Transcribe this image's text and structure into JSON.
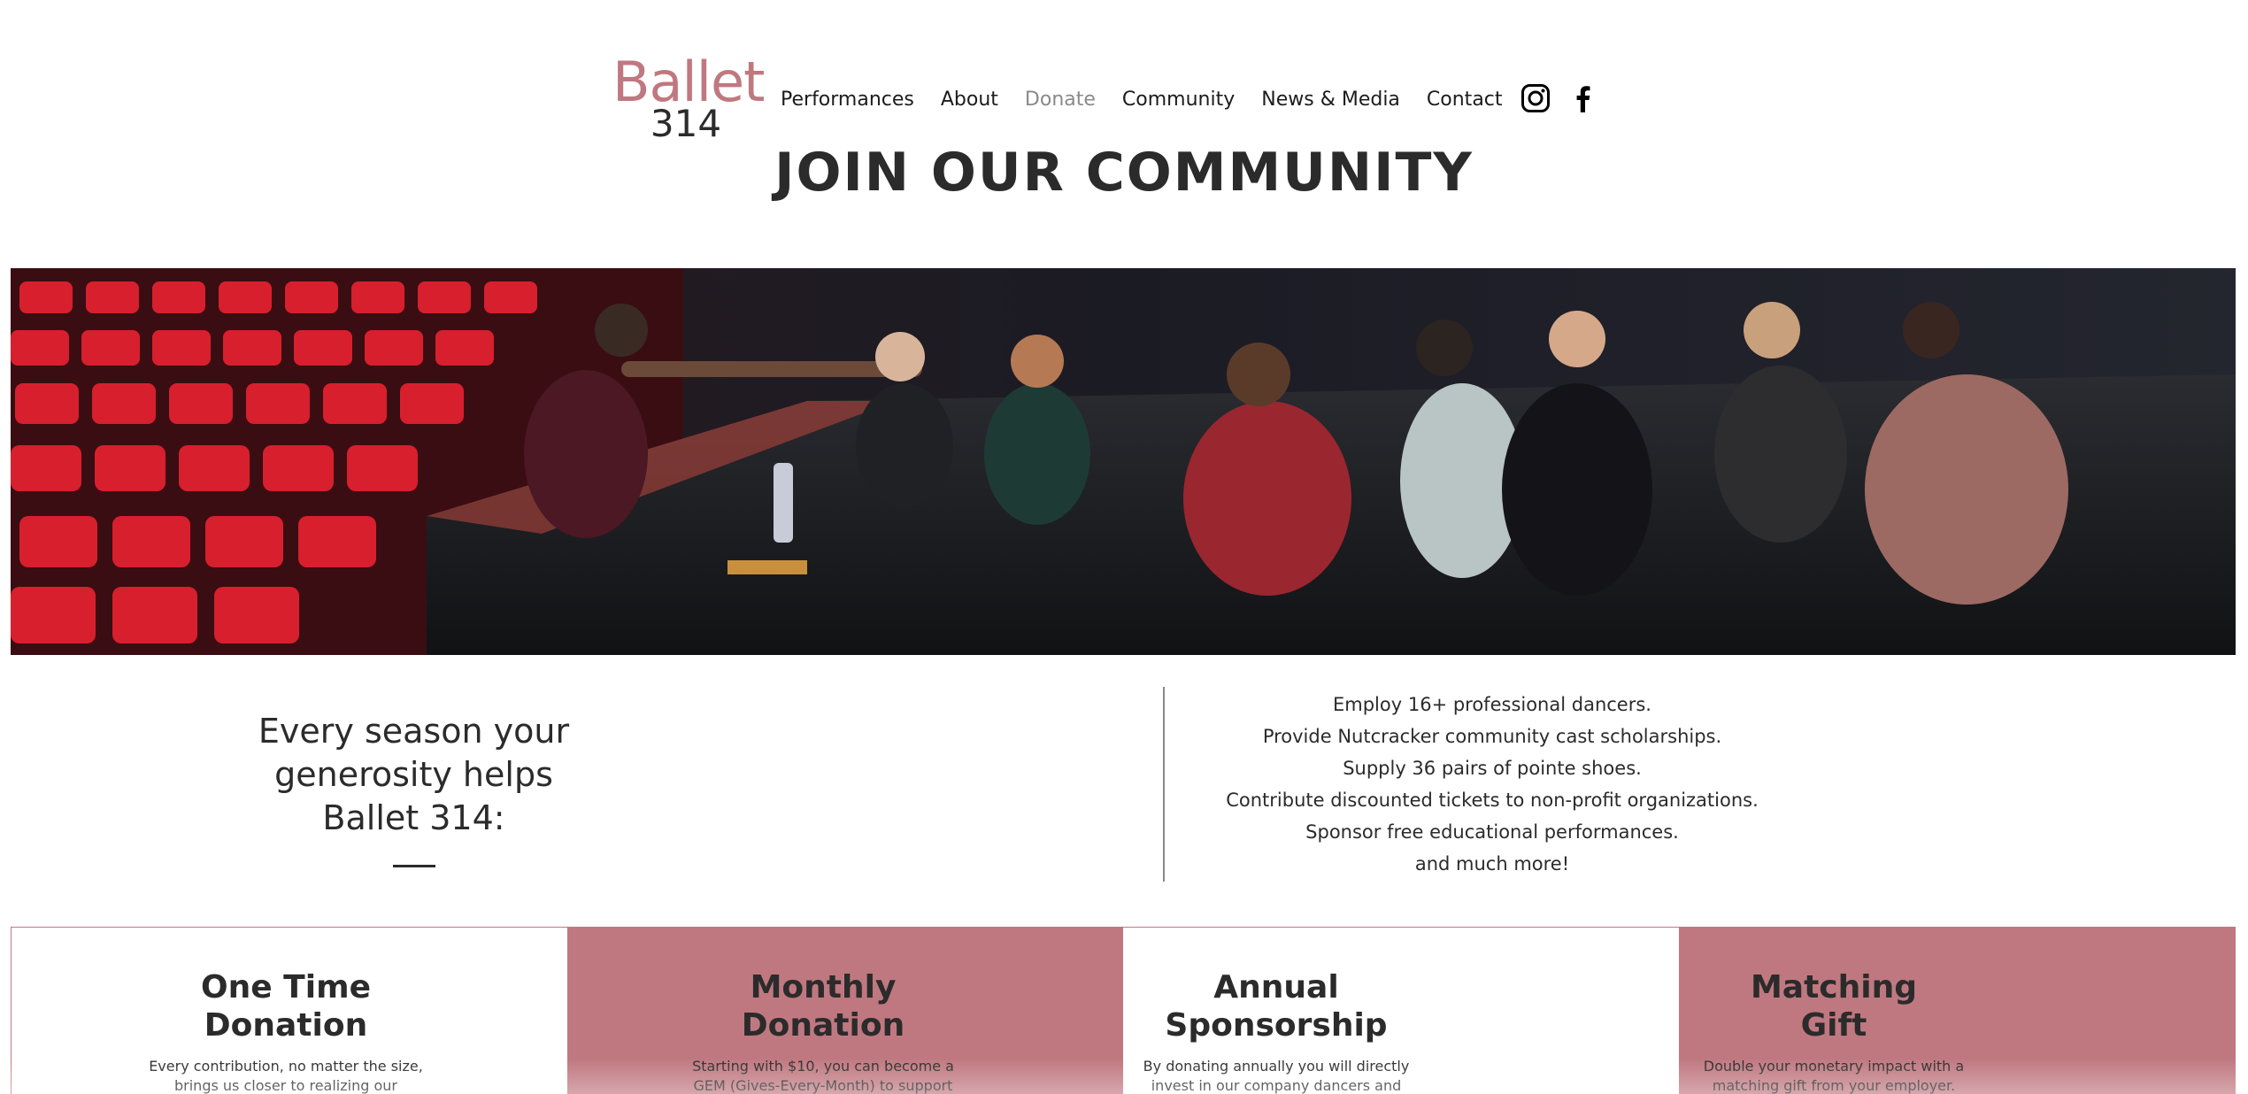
{
  "brand": {
    "word": "Ballet",
    "number": "314",
    "primary_color": "#c07880",
    "dark_color": "#2b2b2b"
  },
  "nav": {
    "items": [
      {
        "label": "Performances"
      },
      {
        "label": "About"
      },
      {
        "label": "Donate",
        "active": true
      },
      {
        "label": "Community"
      },
      {
        "label": "News & Media"
      },
      {
        "label": "Contact"
      }
    ],
    "social": [
      {
        "icon": "instagram-icon"
      },
      {
        "icon": "facebook-icon"
      }
    ]
  },
  "page": {
    "title": "JOIN OUR COMMUNITY"
  },
  "hero": {
    "icon": "hero-photo-dancers-circle"
  },
  "intro": {
    "heading_lines": [
      "Every season your",
      "generosity helps",
      "Ballet 314:"
    ],
    "bullets": [
      "Employ 16+ professional dancers.",
      "Provide Nutcracker community cast scholarships.",
      "Supply 36 pairs of pointe shoes.",
      "Contribute discounted tickets to non-profit organizations.",
      "Sponsor free educational performances.",
      "and much more!"
    ]
  },
  "cards": [
    {
      "title_lines": [
        "One Time",
        "Donation"
      ],
      "desc_lines": [
        "Every contribution, no matter the size,",
        "brings us closer to realizing our"
      ]
    },
    {
      "title_lines": [
        "Monthly",
        "Donation"
      ],
      "desc_lines": [
        "Starting with $10, you can become a",
        "GEM (Gives-Every-Month) to support"
      ]
    },
    {
      "title_lines": [
        "Annual",
        "Sponsorship"
      ],
      "desc_lines": [
        "By donating annually you will directly",
        "invest in our company dancers and"
      ]
    },
    {
      "title_lines": [
        "Matching",
        "Gift"
      ],
      "desc_lines": [
        "Double your monetary impact with a",
        "matching gift from your employer."
      ]
    }
  ]
}
